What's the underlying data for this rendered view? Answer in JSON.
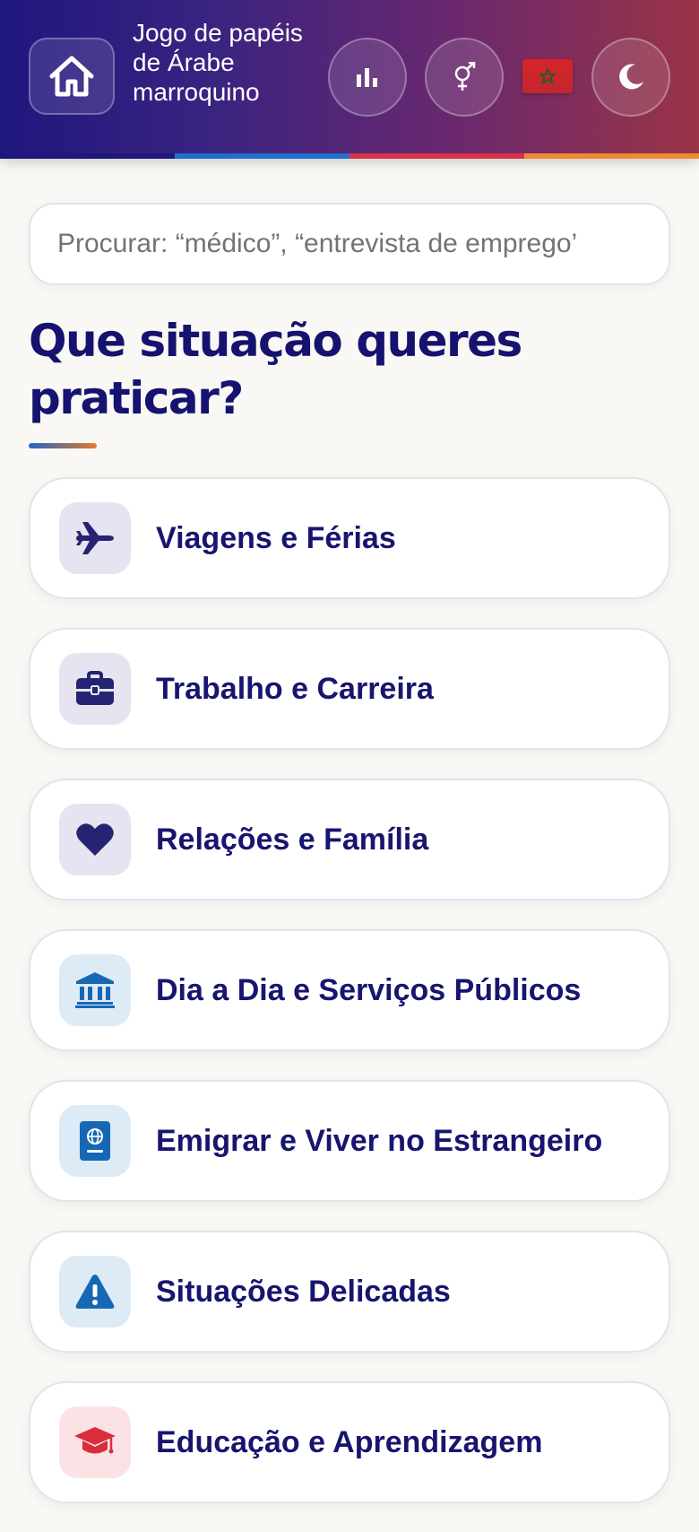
{
  "header": {
    "title": "Jogo de papéis de Árabe marroquino",
    "home_icon": "home-icon",
    "stats_icon": "bar-chart-icon",
    "gender_icon": "gender-icon",
    "language_flag": "morocco-flag",
    "theme_icon": "moon-icon",
    "stripe_colors": [
      "#1f177d",
      "#1f6fd0",
      "#d9324a",
      "#f08a32"
    ]
  },
  "search": {
    "placeholder": "Procurar: “médico”, “entrevista de emprego’"
  },
  "heading": "Que situação queres praticar?",
  "categories": [
    {
      "label": "Viagens e Férias",
      "icon": "airplane-icon",
      "icon_bg": "#e5e4f0",
      "icon_color": "#262373"
    },
    {
      "label": "Trabalho e Carreira",
      "icon": "briefcase-icon",
      "icon_bg": "#e5e4f0",
      "icon_color": "#262373"
    },
    {
      "label": "Relações e Família",
      "icon": "heart-icon",
      "icon_bg": "#e5e4f0",
      "icon_color": "#262373"
    },
    {
      "label": "Dia a Dia e Serviços Públicos",
      "icon": "bank-icon",
      "icon_bg": "#ddebf7",
      "icon_color": "#1768b4"
    },
    {
      "label": "Emigrar e Viver no Estrangeiro",
      "icon": "passport-icon",
      "icon_bg": "#ddebf7",
      "icon_color": "#1768b4"
    },
    {
      "label": "Situações Delicadas",
      "icon": "warning-icon",
      "icon_bg": "#ddebf7",
      "icon_color": "#1768b4"
    },
    {
      "label": "Educação e Aprendizagem",
      "icon": "graduation-cap-icon",
      "icon_bg": "#fbe3e5",
      "icon_color": "#d92d3a"
    }
  ]
}
